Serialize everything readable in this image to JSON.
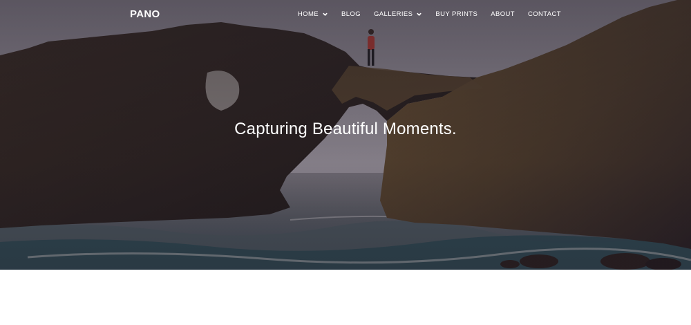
{
  "brand": {
    "logo": "PANO"
  },
  "nav": {
    "items": [
      {
        "label": "HOME",
        "has_dropdown": true
      },
      {
        "label": "BLOG",
        "has_dropdown": false
      },
      {
        "label": "GALLERIES",
        "has_dropdown": true
      },
      {
        "label": "BUY PRINTS",
        "has_dropdown": false
      },
      {
        "label": "ABOUT",
        "has_dropdown": false
      },
      {
        "label": "CONTACT",
        "has_dropdown": false
      }
    ],
    "dropdown_icon": "chevron-down-icon"
  },
  "hero": {
    "tagline": "Capturing Beautiful Moments."
  },
  "colors": {
    "text": "#ffffff",
    "overlay": "#231c2a",
    "page_background": "#ffffff"
  }
}
